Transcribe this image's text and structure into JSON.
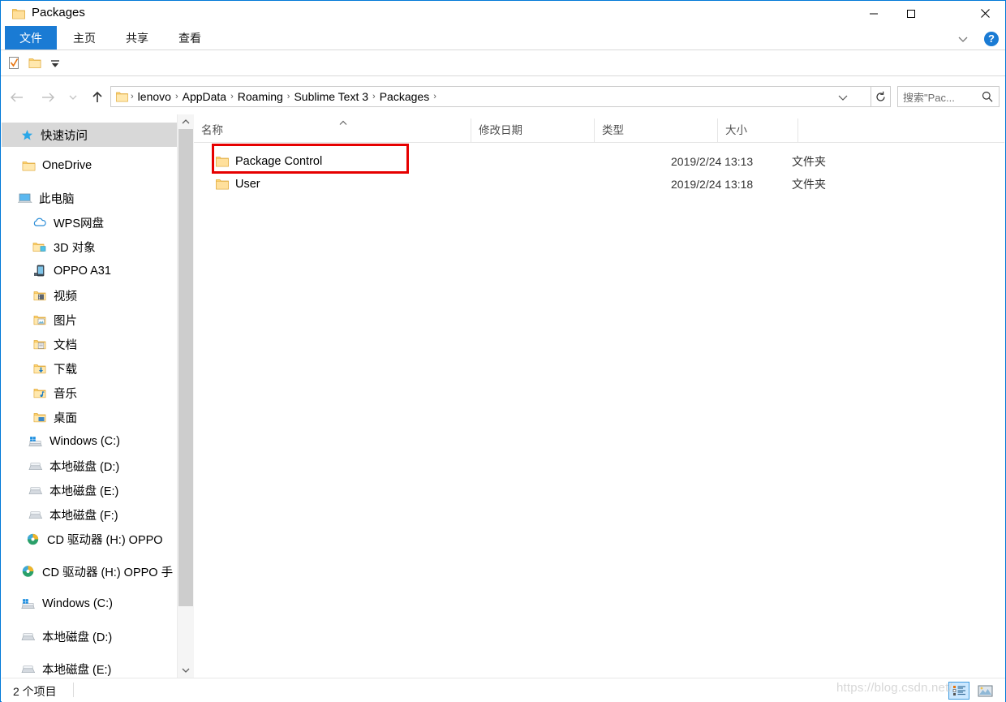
{
  "window": {
    "title": "Packages",
    "controls": {
      "minimize": "—",
      "maximize": "□",
      "close": "✕"
    }
  },
  "ribbon": {
    "tabs": [
      {
        "label": "文件",
        "active": true
      },
      {
        "label": "主页",
        "active": false
      },
      {
        "label": "共享",
        "active": false
      },
      {
        "label": "查看",
        "active": false
      }
    ],
    "help_label": "?",
    "accent_color": "#1a7bd4"
  },
  "quick_access_toolbar": {
    "items": [
      "properties-icon",
      "new-folder-icon",
      "customize-chevron-icon"
    ]
  },
  "addressbar": {
    "nav": {
      "back": "back-arrow-icon",
      "forward": "forward-arrow-icon",
      "recent": "recent-locations-chevron-icon",
      "up": "up-arrow-icon"
    },
    "breadcrumb": [
      "lenovo",
      "AppData",
      "Roaming",
      "Sublime Text 3",
      "Packages"
    ],
    "separator": "›",
    "refresh": "refresh-icon",
    "dropdown": "chevron-down-icon"
  },
  "search": {
    "placeholder": "搜索\"Pac...",
    "icon": "search-icon"
  },
  "sidebar": {
    "items": [
      {
        "label": "快速访问",
        "icon": "pin-star-icon",
        "indent": 0,
        "highlighted": true
      },
      {
        "label": "OneDrive",
        "icon": "onedrive-folder-icon",
        "indent": 0,
        "highlighted": false
      },
      {
        "label": "此电脑",
        "icon": "this-pc-icon",
        "indent": 0,
        "highlighted": false
      },
      {
        "label": "WPS网盘",
        "icon": "cloud-icon",
        "indent": 1,
        "highlighted": false
      },
      {
        "label": "3D 对象",
        "icon": "3d-objects-icon",
        "indent": 1,
        "highlighted": false
      },
      {
        "label": "OPPO A31",
        "icon": "phone-icon",
        "indent": 1,
        "highlighted": false
      },
      {
        "label": "视频",
        "icon": "videos-folder-icon",
        "indent": 1,
        "highlighted": false
      },
      {
        "label": "图片",
        "icon": "pictures-folder-icon",
        "indent": 1,
        "highlighted": false
      },
      {
        "label": "文档",
        "icon": "documents-folder-icon",
        "indent": 1,
        "highlighted": false
      },
      {
        "label": "下载",
        "icon": "downloads-folder-icon",
        "indent": 1,
        "highlighted": false
      },
      {
        "label": "音乐",
        "icon": "music-folder-icon",
        "indent": 1,
        "highlighted": false
      },
      {
        "label": "桌面",
        "icon": "desktop-folder-icon",
        "indent": 1,
        "highlighted": false
      },
      {
        "label": "Windows (C:)",
        "icon": "windows-drive-icon",
        "indent": 1,
        "highlighted": false
      },
      {
        "label": "本地磁盘 (D:)",
        "icon": "drive-icon",
        "indent": 1,
        "highlighted": false
      },
      {
        "label": "本地磁盘 (E:)",
        "icon": "drive-icon",
        "indent": 1,
        "highlighted": false
      },
      {
        "label": "本地磁盘 (F:)",
        "icon": "drive-icon",
        "indent": 1,
        "highlighted": false
      },
      {
        "label": "CD 驱动器 (H:) OPPO",
        "icon": "cd-drive-icon",
        "indent": 1,
        "highlighted": false
      },
      {
        "label": "CD 驱动器 (H:) OPPO 手",
        "icon": "cd-drive-icon",
        "indent": 0,
        "highlighted": false
      },
      {
        "label": "Windows (C:)",
        "icon": "windows-drive-icon",
        "indent": 0,
        "highlighted": false
      },
      {
        "label": "本地磁盘 (D:)",
        "icon": "drive-icon",
        "indent": 0,
        "highlighted": false
      },
      {
        "label": "本地磁盘 (E:)",
        "icon": "drive-icon",
        "indent": 0,
        "highlighted": false
      }
    ]
  },
  "filelist": {
    "columns": [
      {
        "label": "名称",
        "sorted": "asc"
      },
      {
        "label": "修改日期",
        "sorted": ""
      },
      {
        "label": "类型",
        "sorted": ""
      },
      {
        "label": "大小",
        "sorted": ""
      }
    ],
    "rows": [
      {
        "name": "Package Control",
        "date": "2019/2/24 13:13",
        "type": "文件夹",
        "size": "",
        "icon": "folder-icon",
        "annotated": true
      },
      {
        "name": "User",
        "date": "2019/2/24 13:18",
        "type": "文件夹",
        "size": "",
        "icon": "folder-icon",
        "annotated": false
      }
    ]
  },
  "annotation": {
    "color": "#e60000"
  },
  "statusbar": {
    "item_count": "2 个项目",
    "views": [
      {
        "name": "details-view",
        "selected": true
      },
      {
        "name": "large-icons-view",
        "selected": false
      }
    ]
  },
  "watermark": {
    "text": "https://blog.csdn.net/"
  }
}
